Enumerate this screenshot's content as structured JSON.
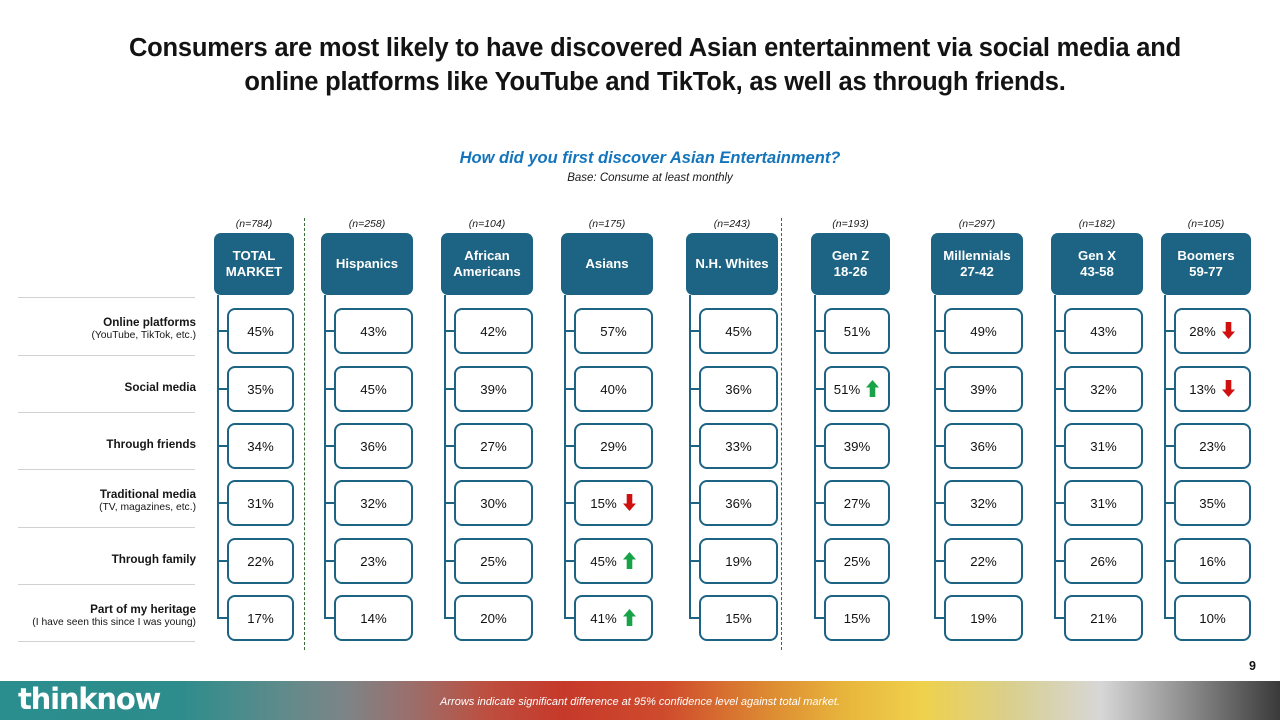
{
  "slide": {
    "title": "Consumers are most likely to have discovered Asian entertainment via social media and online platforms like YouTube and TikTok, as well as through friends.",
    "question": "How did you first discover Asian Entertainment?",
    "base_note": "Base: Consume at least monthly",
    "page_number": "9"
  },
  "footer": {
    "brand": "thinknow",
    "note": "Arrows indicate significant difference at 95% confidence level against total market."
  },
  "colors": {
    "header_box": "#1D6383",
    "question_blue": "#1475BC",
    "up_arrow": "#18A349",
    "down_arrow": "#D00F0F",
    "divider_green": "#3A6B38"
  },
  "rows": [
    {
      "label": "Online platforms",
      "sublabel": "(YouTube,  TikTok, etc.)"
    },
    {
      "label": "Social media",
      "sublabel": ""
    },
    {
      "label": "Through friends",
      "sublabel": ""
    },
    {
      "label": "Traditional media",
      "sublabel": "(TV, magazines, etc.)"
    },
    {
      "label": "Through family",
      "sublabel": ""
    },
    {
      "label": "Part of my heritage",
      "sublabel": "(I have seen this since I was young)"
    }
  ],
  "columns": [
    {
      "name": "TOTAL MARKET",
      "line1": "TOTAL",
      "line2": "MARKET",
      "n": "(n=784)"
    },
    {
      "name": "Hispanics",
      "line1": "Hispanics",
      "line2": "",
      "n": "(n=258)"
    },
    {
      "name": "African Americans",
      "line1": "African",
      "line2": "Americans",
      "n": "(n=104)"
    },
    {
      "name": "Asians",
      "line1": "Asians",
      "line2": "",
      "n": "(n=175)"
    },
    {
      "name": "N.H. Whites",
      "line1": "N.H. Whites",
      "line2": "",
      "n": "(n=243)"
    },
    {
      "name": "Gen Z 18-26",
      "line1": "Gen Z",
      "line2": "18-26",
      "n": "(n=193)"
    },
    {
      "name": "Millennials 27-42",
      "line1": "Millennials",
      "line2": "27-42",
      "n": "(n=297)"
    },
    {
      "name": "Gen X 43-58",
      "line1": "Gen X",
      "line2": "43-58",
      "n": "(n=182)"
    },
    {
      "name": "Boomers 59-77",
      "line1": "Boomers",
      "line2": "59-77",
      "n": "(n=105)"
    }
  ],
  "chart_data": {
    "type": "table",
    "title": "How did you first discover Asian Entertainment?",
    "subtitle": "Base: Consume at least monthly",
    "xlabel": "",
    "ylabel": "",
    "categories": [
      "Online platforms (YouTube, TikTok, etc.)",
      "Social media",
      "Through friends",
      "Traditional media (TV, magazines, etc.)",
      "Through family",
      "Part of my heritage (I have seen this since I was young)"
    ],
    "legend": [
      "green up arrow = significantly higher than total market",
      "red down arrow = significantly lower than total market"
    ],
    "series": [
      {
        "name": "TOTAL MARKET",
        "n": 784,
        "values": [
          45,
          35,
          34,
          31,
          22,
          17
        ],
        "arrows": [
          "",
          "",
          "",
          "",
          "",
          ""
        ]
      },
      {
        "name": "Hispanics",
        "n": 258,
        "values": [
          43,
          45,
          36,
          32,
          23,
          14
        ],
        "arrows": [
          "",
          "",
          "",
          "",
          "",
          ""
        ]
      },
      {
        "name": "African Americans",
        "n": 104,
        "values": [
          42,
          39,
          27,
          30,
          25,
          20
        ],
        "arrows": [
          "",
          "",
          "",
          "",
          "",
          ""
        ]
      },
      {
        "name": "Asians",
        "n": 175,
        "values": [
          57,
          40,
          29,
          15,
          45,
          41
        ],
        "arrows": [
          "",
          "",
          "",
          "down",
          "up",
          "up"
        ]
      },
      {
        "name": "N.H. Whites",
        "n": 243,
        "values": [
          45,
          36,
          33,
          36,
          19,
          15
        ],
        "arrows": [
          "",
          "",
          "",
          "",
          "",
          ""
        ]
      },
      {
        "name": "Gen Z 18-26",
        "n": 193,
        "values": [
          51,
          51,
          39,
          27,
          25,
          15
        ],
        "arrows": [
          "",
          "up",
          "",
          "",
          "",
          ""
        ]
      },
      {
        "name": "Millennials 27-42",
        "n": 297,
        "values": [
          49,
          39,
          36,
          32,
          22,
          19
        ],
        "arrows": [
          "",
          "",
          "",
          "",
          "",
          ""
        ]
      },
      {
        "name": "Gen X 43-58",
        "n": 182,
        "values": [
          43,
          32,
          31,
          31,
          26,
          21
        ],
        "arrows": [
          "",
          "",
          "",
          "",
          "",
          ""
        ]
      },
      {
        "name": "Boomers 59-77",
        "n": 105,
        "values": [
          28,
          13,
          23,
          35,
          16,
          10
        ],
        "arrows": [
          "down",
          "down",
          "",
          "",
          "",
          ""
        ]
      }
    ],
    "cells": [
      [
        "45%",
        "43%",
        "42%",
        "57%",
        "45%",
        "51%",
        "49%",
        "43%",
        "28%"
      ],
      [
        "35%",
        "45%",
        "39%",
        "40%",
        "36%",
        "51%",
        "39%",
        "32%",
        "13%"
      ],
      [
        "34%",
        "36%",
        "27%",
        "29%",
        "33%",
        "39%",
        "36%",
        "31%",
        "23%"
      ],
      [
        "31%",
        "32%",
        "30%",
        "15%",
        "36%",
        "27%",
        "32%",
        "31%",
        "35%"
      ],
      [
        "22%",
        "23%",
        "25%",
        "45%",
        "19%",
        "25%",
        "22%",
        "26%",
        "16%"
      ],
      [
        "17%",
        "14%",
        "20%",
        "41%",
        "15%",
        "15%",
        "19%",
        "21%",
        "10%"
      ]
    ]
  }
}
